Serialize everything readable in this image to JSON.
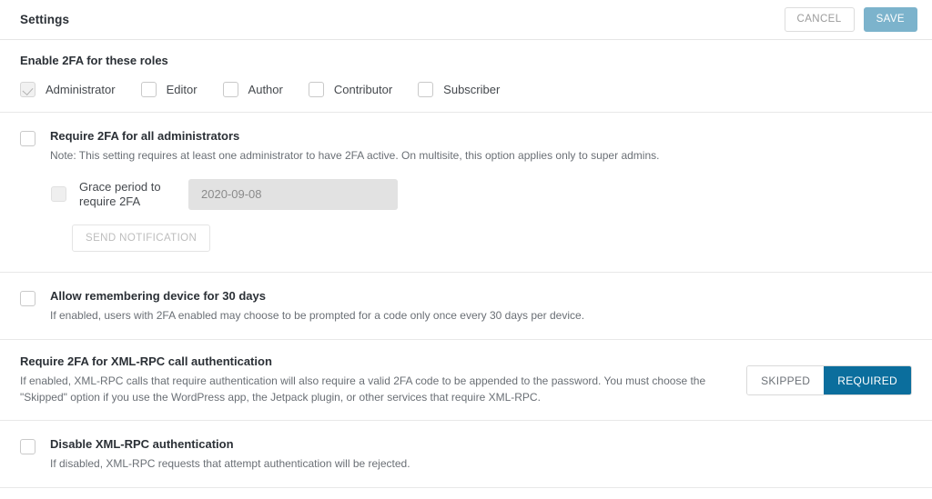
{
  "header": {
    "title": "Settings",
    "cancel_label": "CANCEL",
    "save_label": "SAVE",
    "save_color": "#7cb3cc"
  },
  "roles": {
    "title": "Enable 2FA for these roles",
    "items": [
      {
        "label": "Administrator",
        "checked": true,
        "disabled": true
      },
      {
        "label": "Editor",
        "checked": false,
        "disabled": false
      },
      {
        "label": "Author",
        "checked": false,
        "disabled": false
      },
      {
        "label": "Contributor",
        "checked": false,
        "disabled": false
      },
      {
        "label": "Subscriber",
        "checked": false,
        "disabled": false
      }
    ]
  },
  "require_admins": {
    "title": "Require 2FA for all administrators",
    "description": "Note: This setting requires at least one administrator to have 2FA active. On multisite, this option applies only to super admins.",
    "checked": false,
    "grace": {
      "label": "Grace period to require 2FA",
      "checked": false,
      "date_value": "2020-09-08",
      "send_notification_label": "SEND NOTIFICATION"
    }
  },
  "remember_device": {
    "title": "Allow remembering device for 30 days",
    "description": "If enabled, users with 2FA enabled may choose to be prompted for a code only once every 30 days per device.",
    "checked": false
  },
  "xmlrpc_require": {
    "title": "Require 2FA for XML-RPC call authentication",
    "description": "If enabled, XML-RPC calls that require authentication will also require a valid 2FA code to be appended to the password. You must choose the \"Skipped\" option if you use the WordPress app, the Jetpack plugin, or other services that require XML-RPC.",
    "options": [
      {
        "label": "SKIPPED",
        "selected": false
      },
      {
        "label": "REQUIRED",
        "selected": true
      }
    ],
    "selected_color": "#0b6e9d"
  },
  "xmlrpc_disable": {
    "title": "Disable XML-RPC authentication",
    "description": "If disabled, XML-RPC requests that attempt authentication will be rejected.",
    "checked": false
  }
}
